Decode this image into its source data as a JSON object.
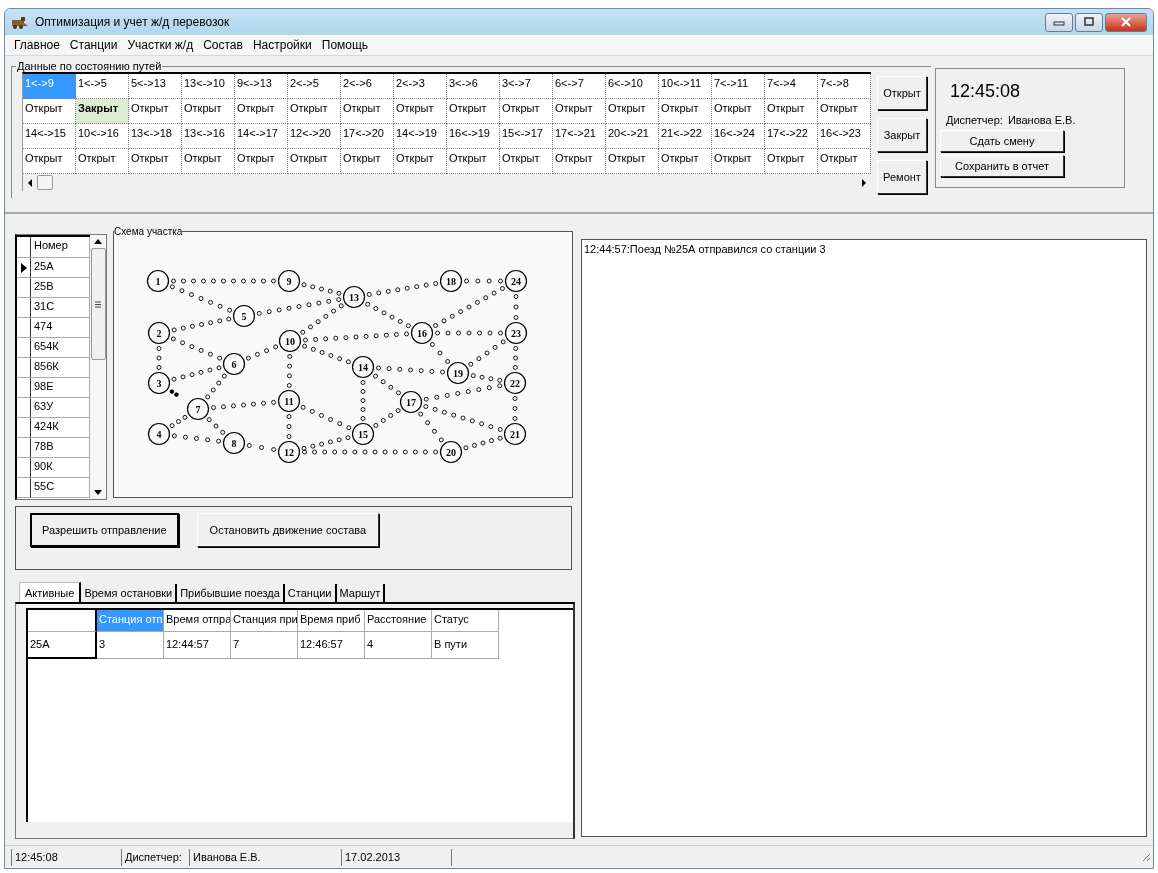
{
  "window": {
    "title": "Оптимизация и учет ж/д перевозок"
  },
  "menu": [
    "Главное",
    "Станции",
    "Участки ж/д",
    "Состав",
    "Настройки",
    "Помощь"
  ],
  "tracks_group": {
    "title": "Данные по состоянию путей",
    "rows": [
      [
        {
          "segment": "1<->9",
          "status": "Открыт",
          "selected": true,
          "closed": false
        },
        {
          "segment": "1<->5",
          "status": "Закрыт",
          "selected": false,
          "closed": true
        },
        {
          "segment": "5<->13",
          "status": "Открыт",
          "selected": false,
          "closed": false
        },
        {
          "segment": "13<->10",
          "status": "Открыт",
          "selected": false,
          "closed": false
        },
        {
          "segment": "9<->13",
          "status": "Открыт",
          "selected": false,
          "closed": false
        },
        {
          "segment": "2<->5",
          "status": "Открыт",
          "selected": false,
          "closed": false
        },
        {
          "segment": "2<->6",
          "status": "Открыт",
          "selected": false,
          "closed": false
        },
        {
          "segment": "2<->3",
          "status": "Открыт",
          "selected": false,
          "closed": false
        },
        {
          "segment": "3<->6",
          "status": "Открыт",
          "selected": false,
          "closed": false
        },
        {
          "segment": "3<->7",
          "status": "Открыт",
          "selected": false,
          "closed": false
        },
        {
          "segment": "6<->7",
          "status": "Открыт",
          "selected": false,
          "closed": false
        },
        {
          "segment": "6<->10",
          "status": "Открыт",
          "selected": false,
          "closed": false
        },
        {
          "segment": "10<->11",
          "status": "Открыт",
          "selected": false,
          "closed": false
        },
        {
          "segment": "7<->11",
          "status": "Открыт",
          "selected": false,
          "closed": false
        },
        {
          "segment": "7<->4",
          "status": "Открыт",
          "selected": false,
          "closed": false
        },
        {
          "segment": "7<->8",
          "status": "Открыт",
          "selected": false,
          "closed": false
        }
      ],
      [
        {
          "segment": "14<->15",
          "status": "Открыт",
          "selected": false,
          "closed": false
        },
        {
          "segment": "10<->16",
          "status": "Открыт",
          "selected": false,
          "closed": false
        },
        {
          "segment": "13<->18",
          "status": "Открыт",
          "selected": false,
          "closed": false
        },
        {
          "segment": "13<->16",
          "status": "Открыт",
          "selected": false,
          "closed": false
        },
        {
          "segment": "14<->17",
          "status": "Открыт",
          "selected": false,
          "closed": false
        },
        {
          "segment": "12<->20",
          "status": "Открыт",
          "selected": false,
          "closed": false
        },
        {
          "segment": "17<->20",
          "status": "Открыт",
          "selected": false,
          "closed": false
        },
        {
          "segment": "14<->19",
          "status": "Открыт",
          "selected": false,
          "closed": false
        },
        {
          "segment": "16<->19",
          "status": "Открыт",
          "selected": false,
          "closed": false
        },
        {
          "segment": "15<->17",
          "status": "Открыт",
          "selected": false,
          "closed": false
        },
        {
          "segment": "17<->21",
          "status": "Открыт",
          "selected": false,
          "closed": false
        },
        {
          "segment": "20<->21",
          "status": "Открыт",
          "selected": false,
          "closed": false
        },
        {
          "segment": "21<->22",
          "status": "Открыт",
          "selected": false,
          "closed": false
        },
        {
          "segment": "16<->24",
          "status": "Открыт",
          "selected": false,
          "closed": false
        },
        {
          "segment": "17<->22",
          "status": "Открыт",
          "selected": false,
          "closed": false
        },
        {
          "segment": "16<->23",
          "status": "Открыт",
          "selected": false,
          "closed": false
        }
      ]
    ]
  },
  "track_buttons": [
    "Открыт",
    "Закрыт",
    "Ремонт"
  ],
  "shift_panel": {
    "clock": "12:45:08",
    "dispatcher_label": "Диспетчер:",
    "dispatcher_name": "Иванова Е.В.",
    "buttons": [
      "Сдать смену",
      "Сохранить  в отчет"
    ]
  },
  "trains": {
    "column": "Номер",
    "rows": [
      {
        "number": "25А",
        "selected": true
      },
      {
        "number": "25В",
        "selected": false
      },
      {
        "number": "31С",
        "selected": false
      },
      {
        "number": "474",
        "selected": false
      },
      {
        "number": "654К",
        "selected": false
      },
      {
        "number": "856К",
        "selected": false
      },
      {
        "number": "98Е",
        "selected": false
      },
      {
        "number": "63У",
        "selected": false
      },
      {
        "number": "424К",
        "selected": false
      },
      {
        "number": "78В",
        "selected": false
      },
      {
        "number": "90К",
        "selected": false
      },
      {
        "number": "55С",
        "selected": false
      }
    ]
  },
  "scheme": {
    "title": "Схема участка",
    "stations": [
      "1",
      "9",
      "18",
      "24",
      "13",
      "5",
      "2",
      "16",
      "23",
      "10",
      "6",
      "14",
      "19",
      "3",
      "22",
      "11",
      "17",
      "7",
      "4",
      "15",
      "21",
      "8",
      "12",
      "20"
    ]
  },
  "actions": [
    "Разрешить отправление",
    "Остановить движение состава"
  ],
  "tabs": [
    {
      "label": "Активные",
      "selected": true
    },
    {
      "label": "Время остановки",
      "selected": false
    },
    {
      "label": "Прибывшие поезда",
      "selected": false
    },
    {
      "label": "Станции",
      "selected": false
    },
    {
      "label": "Маршут",
      "selected": false
    }
  ],
  "table": {
    "columns": [
      {
        "label": "Станция отп",
        "selected": true
      },
      {
        "label": "Время отпра",
        "selected": false
      },
      {
        "label": "Станция при",
        "selected": false
      },
      {
        "label": "Время приб",
        "selected": false
      },
      {
        "label": "Расстояние",
        "selected": false
      },
      {
        "label": "Статус",
        "selected": false
      }
    ],
    "rows": [
      {
        "header": "25А",
        "cells": [
          "3",
          "12:44:57",
          "7",
          "12:46:57",
          "4",
          "В пути"
        ]
      }
    ]
  },
  "log": [
    "12:44:57:Поезд №25А отправился со станции 3"
  ],
  "status_bar": [
    "12:45:08",
    "Диспетчер:",
    "Иванова Е.В.",
    "17.02.2013"
  ]
}
